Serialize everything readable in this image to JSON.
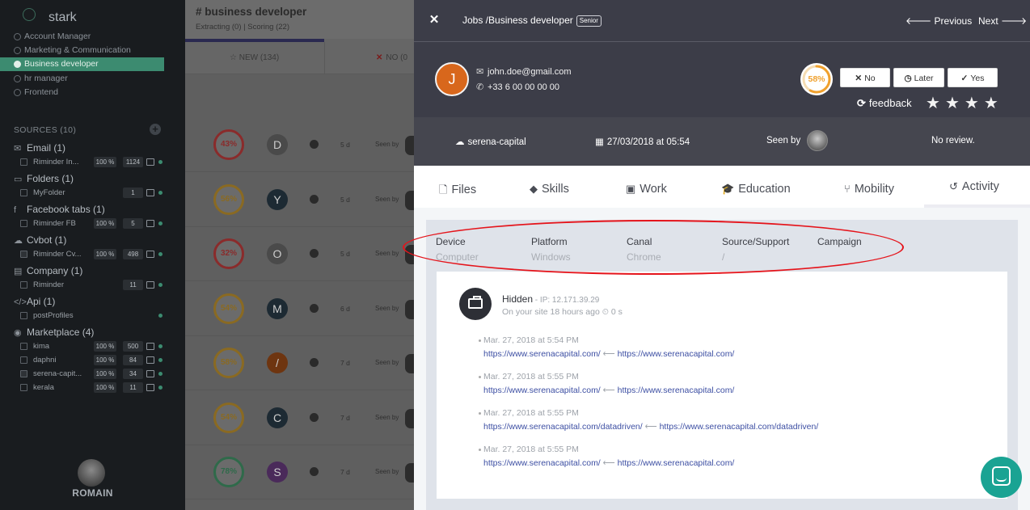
{
  "sidebar": {
    "app_name": "stark",
    "jobs": [
      "Account Manager",
      "Marketing & Communication",
      "Business developer",
      "hr manager",
      "Frontend"
    ],
    "sources_label": "SOURCES",
    "sources_count": "(10)",
    "groups": [
      {
        "icon": "✉",
        "label": "Email (1)",
        "items": [
          {
            "name": "Riminder In...",
            "pct": "100 %",
            "count": "1124"
          }
        ]
      },
      {
        "icon": "▭",
        "label": "Folders (1)",
        "items": [
          {
            "name": "MyFolder",
            "pct": "",
            "count": "1"
          }
        ]
      },
      {
        "icon": "f",
        "label": "Facebook tabs (1)",
        "items": [
          {
            "name": "Riminder FB",
            "pct": "100 %",
            "count": "5"
          }
        ]
      },
      {
        "icon": "☁",
        "label": "Cvbot (1)",
        "items": [
          {
            "name": "Riminder Cv...",
            "pct": "100 %",
            "count": "498"
          }
        ]
      },
      {
        "icon": "▤",
        "label": "Company (1)",
        "items": [
          {
            "name": "Riminder",
            "pct": "",
            "count": "11"
          }
        ]
      },
      {
        "icon": "</>",
        "label": "Api (1)",
        "items": [
          {
            "name": "postProfiles",
            "pct": "",
            "count": ""
          }
        ]
      },
      {
        "icon": "◉",
        "label": "Marketplace (4)",
        "items": [
          {
            "name": "kima",
            "pct": "100 %",
            "count": "500"
          },
          {
            "name": "daphni",
            "pct": "100 %",
            "count": "84"
          },
          {
            "name": "serena-capit...",
            "pct": "100 %",
            "count": "34"
          },
          {
            "name": "kerala",
            "pct": "100 %",
            "count": "11"
          }
        ]
      }
    ],
    "user_name": "ROMAIN"
  },
  "middle": {
    "job_title": "# business developer",
    "job_sub": "Extracting (0)  |  Scoring (22)",
    "tab_new": "☆  NEW (134)",
    "tab_no": "NO (0",
    "rows": [
      {
        "score": "43%",
        "color": "#8a2b2b",
        "avatar": "D",
        "avbg": "#4a4a4a",
        "days": "5 d",
        "seen": "Seen by"
      },
      {
        "score": "56%",
        "color": "#8a6a22",
        "avatar": "Y",
        "avbg": "#1d2a33",
        "days": "5 d",
        "seen": "Seen by"
      },
      {
        "score": "32%",
        "color": "#8a2b2b",
        "avatar": "O",
        "avbg": "#4a4a4a",
        "days": "5 d",
        "seen": "Seen by"
      },
      {
        "score": "54%",
        "color": "#8a6a22",
        "avatar": "M",
        "avbg": "#1d2a33",
        "days": "6 d",
        "seen": "Seen by"
      },
      {
        "score": "58%",
        "color": "#8a6a22",
        "avatar": "/",
        "avbg": "#6e3510",
        "days": "7 d",
        "seen": "Seen by"
      },
      {
        "score": "54%",
        "color": "#8a6a22",
        "avatar": "C",
        "avbg": "#1d2a33",
        "days": "7 d",
        "seen": "Seen by"
      },
      {
        "score": "78%",
        "color": "#2f6a4a",
        "avatar": "S",
        "avbg": "#4a2a5a",
        "days": "7 d",
        "seen": "Seen by"
      }
    ]
  },
  "panel": {
    "breadcrumb": "Jobs /Business developer",
    "badge": "Senior",
    "prev_label": "Previous",
    "next_label": "Next",
    "candidate_initial": "J",
    "email": "john.doe@gmail.com",
    "phone": "+33 6 00 00 00 00",
    "score": "58%",
    "score_value": 0.58,
    "btn_no": "No",
    "btn_later": "Later",
    "btn_yes": "Yes",
    "feedback_label": "feedback",
    "stars": 4,
    "source": "serena-capital",
    "date": "27/03/2018 at 05:54",
    "seen_by": "Seen by",
    "review": "No review.",
    "tabs": [
      {
        "icon": "🗋",
        "label": "Files"
      },
      {
        "icon": "◆",
        "label": "Skills"
      },
      {
        "icon": "▣",
        "label": "Work"
      },
      {
        "icon": "🎓",
        "label": "Education"
      },
      {
        "icon": "⑂",
        "label": "Mobility"
      },
      {
        "icon": "↺",
        "label": "Activity"
      }
    ],
    "meta": [
      {
        "label": "Device",
        "value": "Computer"
      },
      {
        "label": "Platform",
        "value": "Windows"
      },
      {
        "label": "Canal",
        "value": "Chrome"
      },
      {
        "label": "Source/Support",
        "value": "/"
      },
      {
        "label": "Campaign",
        "value": ""
      }
    ],
    "activity": {
      "title": "Hidden",
      "ip": " - IP: 12.171.39.29",
      "subtitle": "On your site 18 hours ago  ⏲ 0 s",
      "events": [
        {
          "date": "Mar. 27, 2018 at 5:54 PM",
          "to": "https://www.serenacapital.com/",
          "from": "https://www.serenacapital.com/"
        },
        {
          "date": "Mar. 27, 2018 at 5:55 PM",
          "to": "https://www.serenacapital.com/",
          "from": "https://www.serenacapital.com/"
        },
        {
          "date": "Mar. 27, 2018 at 5:55 PM",
          "to": "https://www.serenacapital.com/datadriven/",
          "from": "https://www.serenacapital.com/datadriven/"
        },
        {
          "date": "Mar. 27, 2018 at 5:55 PM",
          "to": "https://www.serenacapital.com/",
          "from": "https://www.serenacapital.com/"
        }
      ]
    }
  }
}
